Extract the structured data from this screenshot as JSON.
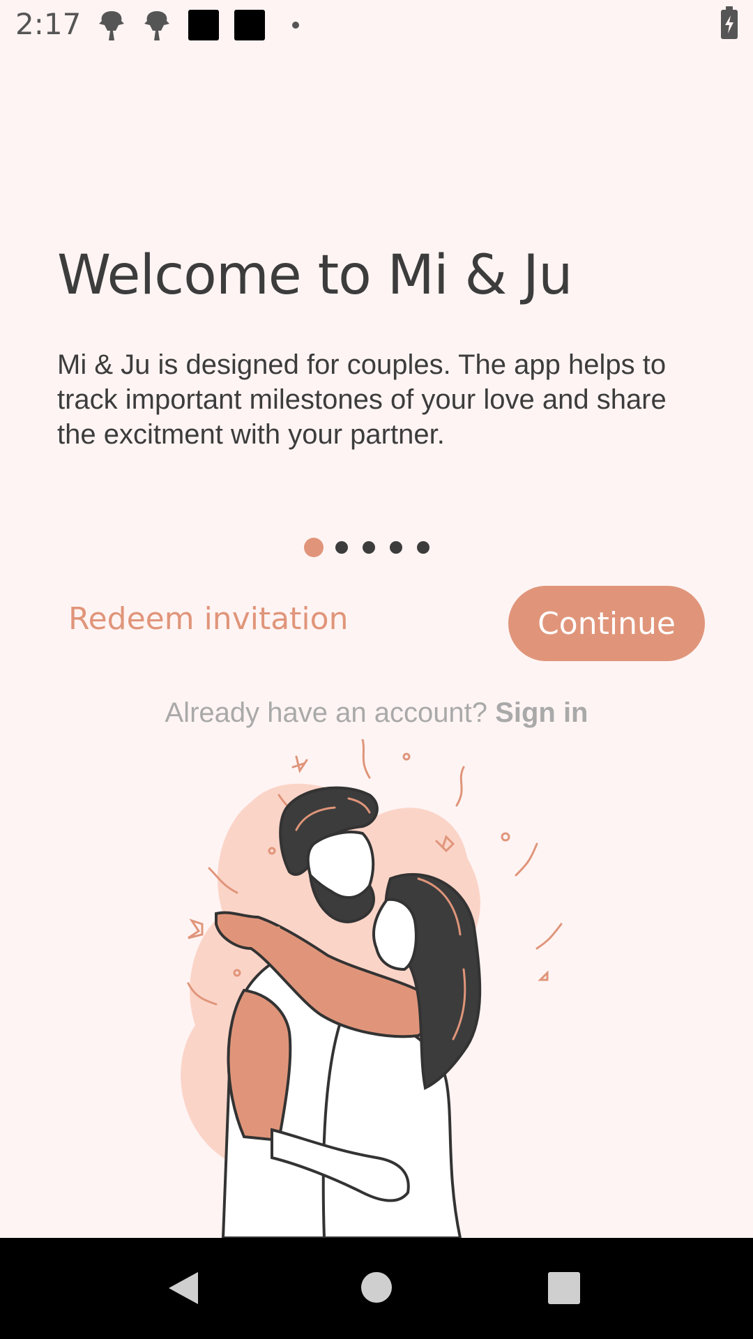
{
  "status_bar": {
    "time": "2:17",
    "icons": [
      "notification-icon",
      "notification-icon",
      "app-square-icon",
      "app-square-icon",
      "dot-icon",
      "battery-charging-icon"
    ]
  },
  "onboarding": {
    "title": "Welcome to Mi & Ju",
    "description": "Mi & Ju is designed for couples. The app helps to track important milestones of your love and share the excitment with your partner.",
    "pager": {
      "total": 5,
      "current": 1
    }
  },
  "actions": {
    "redeem_label": "Redeem invitation",
    "continue_label": "Continue"
  },
  "signin": {
    "prompt": "Already have an account?",
    "link": "Sign in"
  },
  "nav_bar": {
    "icons": [
      "back-icon",
      "home-icon",
      "recents-icon"
    ]
  },
  "colors": {
    "background": "#fef4f3",
    "accent": "#e0957a",
    "text": "#3c3c3c",
    "muted": "#a9a9a9"
  }
}
